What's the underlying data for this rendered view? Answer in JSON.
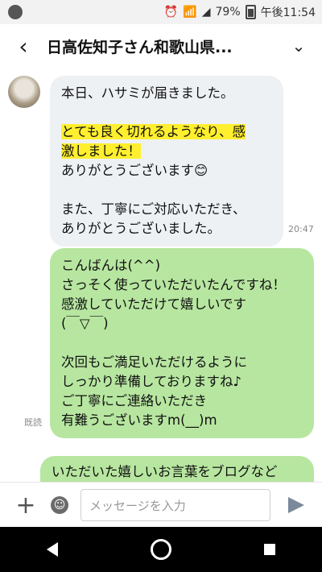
{
  "status_bar": {
    "battery": "79%",
    "time": "午後11:54"
  },
  "header": {
    "title": "日高佐知子さん和歌山県..."
  },
  "messages": {
    "incoming": {
      "line1": "本日、ハサミが届きました。",
      "line2": "とても良く切れるようなり、感",
      "line3": "激しました！",
      "line4": "ありがとうございます😊",
      "line5": "また、丁寧にご対応いただき、",
      "line6": "ありがとうございました。",
      "time": "20:47"
    },
    "outgoing": {
      "line1": "こんばんは(^^)",
      "line2": "さっそく使っていただいたんですね！",
      "line3": "感激していただけて嬉しいです",
      "line4": "(￣▽￣)",
      "line5": "次回もご満足いただけるように",
      "line6": "しっかり準備しておりますね♪",
      "line7": "ご丁寧にご連絡いただき",
      "line8": "有難うございますm(__)m",
      "read": "既読"
    },
    "outgoing_partial": {
      "line1": "いただいた嬉しいお言葉をブログなど"
    }
  },
  "input": {
    "placeholder": "メッセージを入力"
  }
}
